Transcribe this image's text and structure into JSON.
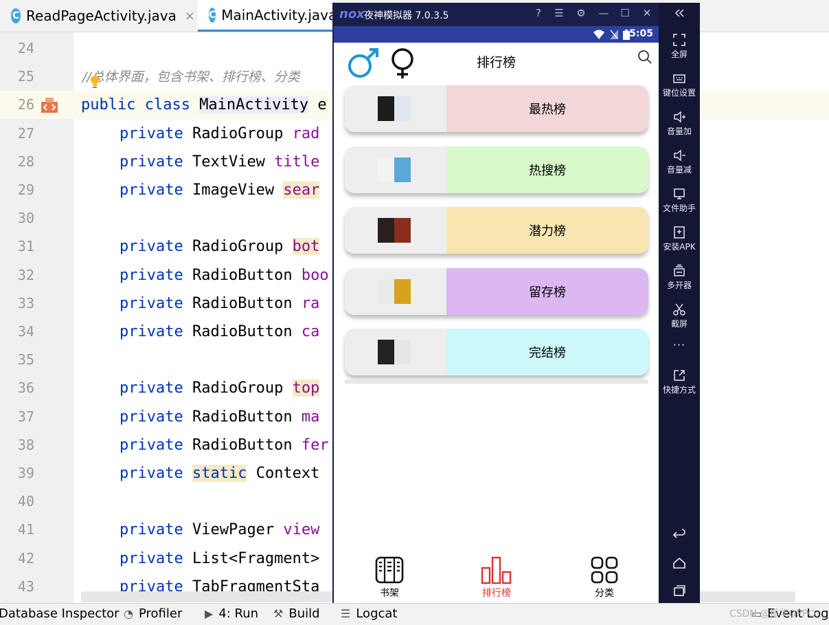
{
  "ide": {
    "tabs": [
      {
        "label": "ReadPageActivity.java",
        "close": "×"
      },
      {
        "label": "MainActivity.java"
      }
    ],
    "lines": [
      {
        "num": "24"
      },
      {
        "num": "25",
        "comment": "//总体界面，包含书架、排行榜、分类"
      },
      {
        "num": "26",
        "kw": "public class ",
        "name": "MainActivity",
        "rest": " e"
      },
      {
        "num": "27",
        "kw": "private ",
        "type": "RadioGroup ",
        "field": "rad"
      },
      {
        "num": "28",
        "kw": "private ",
        "type": "TextView ",
        "field": "title"
      },
      {
        "num": "29",
        "kw": "private ",
        "type": "ImageView ",
        "field": "sear"
      },
      {
        "num": "30"
      },
      {
        "num": "31",
        "kw": "private ",
        "type": "RadioGroup ",
        "field": "bot"
      },
      {
        "num": "32",
        "kw": "private ",
        "type": "RadioButton ",
        "field": "boo"
      },
      {
        "num": "33",
        "kw": "private ",
        "type": "RadioButton ",
        "field": "ra"
      },
      {
        "num": "34",
        "kw": "private ",
        "type": "RadioButton ",
        "field": "ca"
      },
      {
        "num": "35"
      },
      {
        "num": "36",
        "kw": "private ",
        "type": "RadioGroup ",
        "field": "top"
      },
      {
        "num": "37",
        "kw": "private ",
        "type": "RadioButton ",
        "field": "ma"
      },
      {
        "num": "38",
        "kw": "private ",
        "type": "RadioButton ",
        "field": "fer"
      },
      {
        "num": "39",
        "kw": "private ",
        "kw2": "static",
        "type": " Context"
      },
      {
        "num": "40"
      },
      {
        "num": "41",
        "kw": "private ",
        "type": "ViewPager ",
        "field": "view"
      },
      {
        "num": "42",
        "kw": "private ",
        "type": "List<Fragment>"
      },
      {
        "num": "43",
        "kw": "private ",
        "type": "TabFragmentSta"
      }
    ],
    "bottom_tools": [
      {
        "label": "Database Inspector"
      },
      {
        "label": "Profiler"
      },
      {
        "label": "4: Run"
      },
      {
        "label": "Build"
      },
      {
        "label": "Logcat"
      },
      {
        "label": "Event Log"
      }
    ],
    "watermark": "CSDN @振华OPPO"
  },
  "emulator": {
    "logo": "nox",
    "title": "夜神模拟器 7.0.3.5",
    "side_items": [
      "全屏",
      "键位设置",
      "音量加",
      "音量减",
      "文件助手",
      "安装APK",
      "多开器",
      "截屏",
      "···",
      "快捷方式"
    ],
    "status_time": "5:05",
    "app_title": "排行榜",
    "rank_lists": [
      {
        "label": "最热榜",
        "color": "#f2d7d9"
      },
      {
        "label": "热搜榜",
        "color": "#d8f9c9"
      },
      {
        "label": "潜力榜",
        "color": "#f7e6b0"
      },
      {
        "label": "留存榜",
        "color": "#dcb8f2"
      },
      {
        "label": "完结榜",
        "color": "#ccfafa"
      }
    ],
    "bottom_nav": [
      {
        "label": "书架",
        "color": "#000000",
        "selected": false
      },
      {
        "label": "排行榜",
        "color": "#e0322a",
        "selected": true
      },
      {
        "label": "分类",
        "color": "#000000",
        "selected": false
      }
    ]
  }
}
